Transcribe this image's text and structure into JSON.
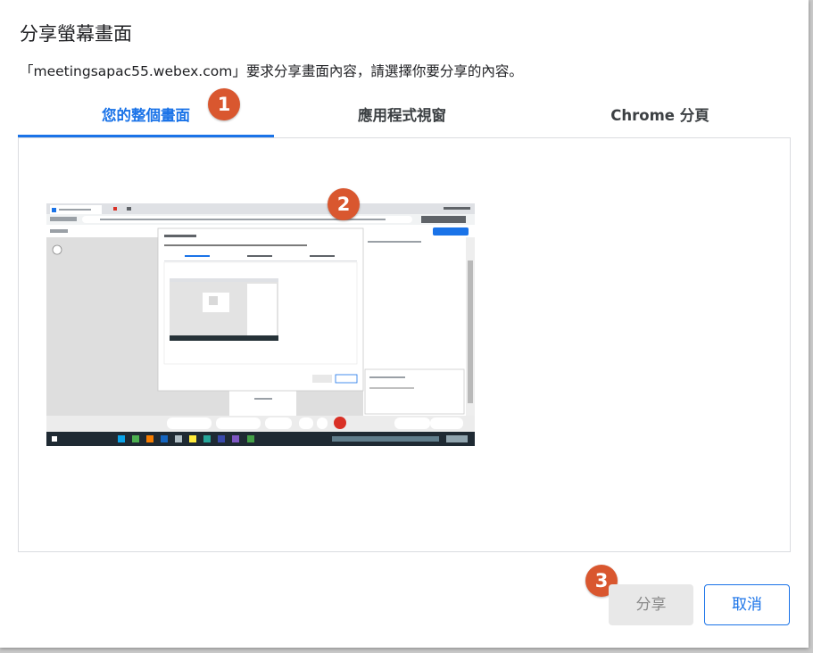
{
  "dialog": {
    "title": "分享螢幕畫面",
    "description": "「meetingsapac55.webex.com」要求分享畫面內容，請選擇你要分享的內容。"
  },
  "tabs": [
    {
      "label": "您的整個畫面",
      "selected": true
    },
    {
      "label": "應用程式視窗",
      "selected": false
    },
    {
      "label": "Chrome 分頁",
      "selected": false
    }
  ],
  "badges": [
    "1",
    "2",
    "3"
  ],
  "buttons": {
    "share": "分享",
    "share_enabled": false,
    "cancel": "取消"
  },
  "colors": {
    "accent": "#1a73e8",
    "badge": "#d9572f",
    "disabled_bg": "#e8e8e8"
  }
}
